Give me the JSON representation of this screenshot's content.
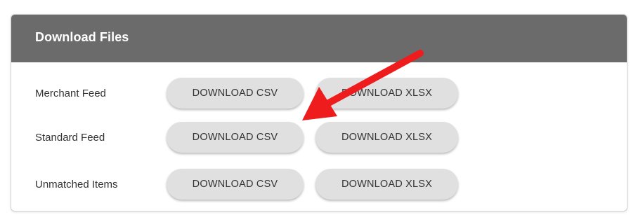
{
  "panel": {
    "title": "Download Files"
  },
  "rows": [
    {
      "label": "Merchant Feed",
      "csv_label": "DOWNLOAD CSV",
      "xlsx_label": "DOWNLOAD XLSX"
    },
    {
      "label": "Standard Feed",
      "csv_label": "DOWNLOAD CSV",
      "xlsx_label": "DOWNLOAD XLSX"
    },
    {
      "label": "Unmatched Items",
      "csv_label": "DOWNLOAD CSV",
      "xlsx_label": "DOWNLOAD XLSX"
    }
  ],
  "colors": {
    "header_bg": "#6b6b6b",
    "button_bg": "#e0e0e0",
    "annotation_arrow": "#ee1c1c"
  },
  "icons": {
    "annotation": "red-arrow-icon"
  }
}
